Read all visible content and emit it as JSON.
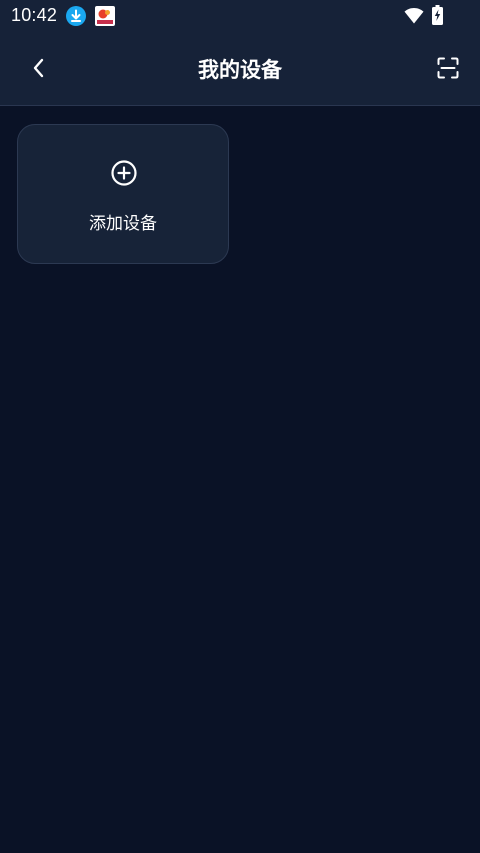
{
  "status_bar": {
    "time": "10:42",
    "icons": [
      "download-icon",
      "app-badge-icon",
      "wifi-icon",
      "battery-charging-icon"
    ]
  },
  "nav": {
    "title": "我的设备",
    "back_icon": "chevron-left-icon",
    "scan_icon": "scan-icon"
  },
  "devices": {
    "add_label": "添加设备",
    "add_icon": "plus-circle-icon"
  },
  "colors": {
    "background": "#0a1226",
    "header": "#162238",
    "card": "#172338",
    "card_border": "#2c3952",
    "download_badge": "#1aa8f0"
  }
}
